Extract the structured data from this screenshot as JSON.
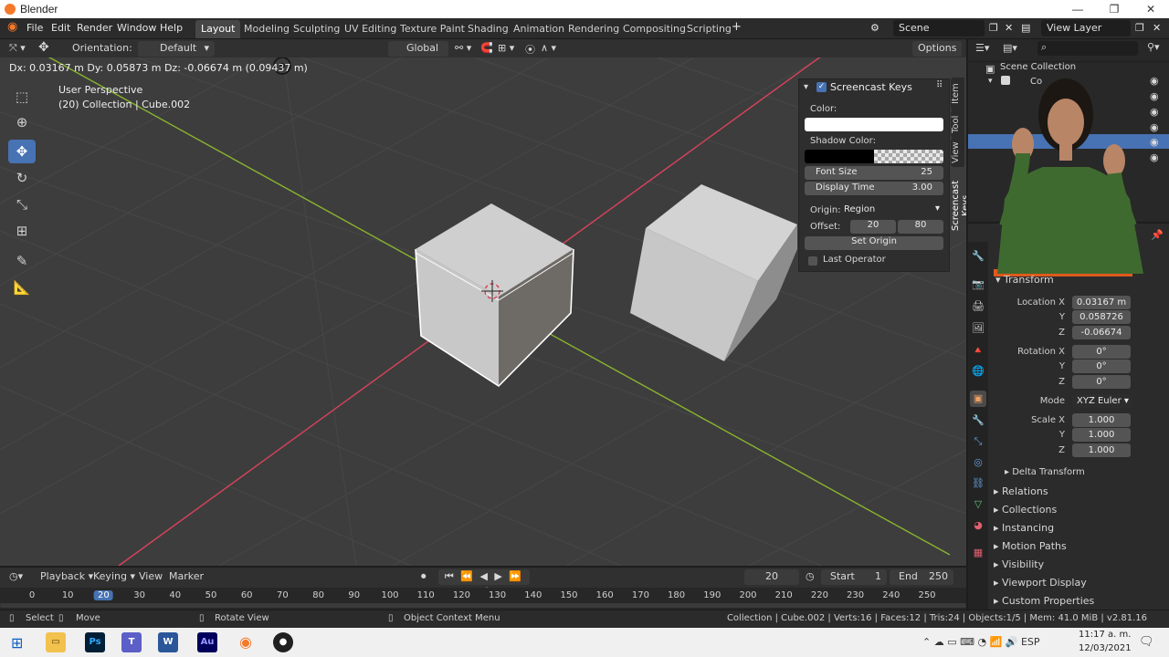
{
  "window": {
    "title": "Blender"
  },
  "menu": [
    "File",
    "Edit",
    "Render",
    "Window",
    "Help"
  ],
  "workspaces": [
    "Layout",
    "Modeling",
    "Sculpting",
    "UV Editing",
    "Texture Paint",
    "Shading",
    "Animation",
    "Rendering",
    "Compositing",
    "Scripting"
  ],
  "active_workspace": "Layout",
  "scene": {
    "name": "Scene",
    "view_layer": "View Layer"
  },
  "viewport_header": {
    "orientation_label": "Orientation:",
    "orientation_value": "Default",
    "transform_orientation": "Global",
    "options_label": "Options"
  },
  "viewport": {
    "operator_status": "Dx: 0.03167 m   Dy: 0.05873 m   Dz: -0.06674 m (0.09437 m)",
    "perspective": "User Perspective",
    "collection_info": "(20) Collection | Cube.002"
  },
  "screencast_panel": {
    "title": "Screencast Keys",
    "color_label": "Color:",
    "shadow_color_label": "Shadow Color:",
    "font_size_label": "Font Size",
    "font_size_value": "25",
    "display_time_label": "Display Time",
    "display_time_value": "3.00",
    "origin_label": "Origin:",
    "origin_value": "Region",
    "offset_label": "Offset:",
    "offset_x": "20",
    "offset_y": "80",
    "set_origin_label": "Set Origin",
    "last_operator_label": "Last Operator"
  },
  "side_tabs": [
    "Item",
    "Tool",
    "View",
    "Screencast Keys"
  ],
  "outliner": {
    "scene_collection": "Scene Collection",
    "collection_prefix": "Co"
  },
  "properties": {
    "transform_label": "Transform",
    "location_x_label": "Location X",
    "location_x": "0.03167 m",
    "location_y": "0.058726",
    "location_z": "-0.06674",
    "rotation_x_label": "Rotation X",
    "rotation_x": "0°",
    "rotation_y": "0°",
    "rotation_z": "0°",
    "mode_label": "Mode",
    "mode_value": "XYZ Euler",
    "scale_x_label": "Scale X",
    "scale_x": "1.000",
    "scale_y": "1.000",
    "scale_z": "1.000",
    "y_label": "Y",
    "z_label": "Z",
    "sections": [
      "Delta Transform",
      "Relations",
      "Collections",
      "Instancing",
      "Motion Paths",
      "Visibility",
      "Viewport Display",
      "Custom Properties"
    ]
  },
  "timeline": {
    "menus": [
      "Playback",
      "Keying",
      "View",
      "Marker"
    ],
    "current_frame": "20",
    "start_label": "Start",
    "start_value": "1",
    "end_label": "End",
    "end_value": "250",
    "ticks": [
      "0",
      "10",
      "20",
      "30",
      "40",
      "50",
      "60",
      "70",
      "80",
      "90",
      "100",
      "110",
      "120",
      "130",
      "140",
      "150",
      "160",
      "170",
      "180",
      "190",
      "200",
      "210",
      "220",
      "230",
      "240",
      "250"
    ]
  },
  "statusbar": {
    "select": "Select",
    "move": "Move",
    "rotate_view": "Rotate View",
    "context_menu": "Object Context Menu",
    "stats": "Collection | Cube.002 | Verts:16 | Faces:12 | Tris:24 | Objects:1/5 | Mem: 41.0 MiB | v2.81.16"
  },
  "taskbar": {
    "time": "11:17 a. m.",
    "date": "12/03/2021",
    "apps": [
      "Ps",
      "Au"
    ]
  },
  "colors": {
    "accent_blue": "#4772b3",
    "x_axis": "#d9435a",
    "y_axis": "#8ab22f",
    "orange": "#f5792a"
  }
}
